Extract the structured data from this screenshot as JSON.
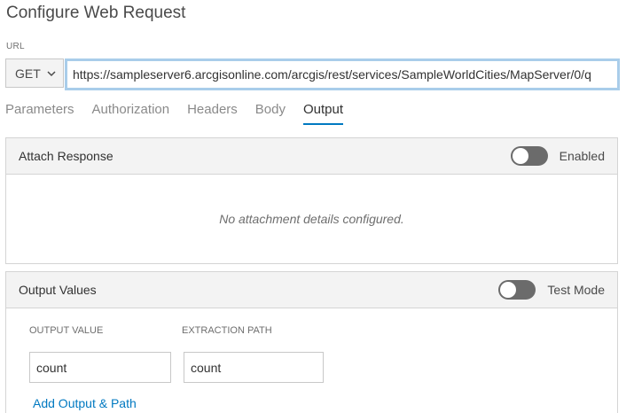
{
  "dialog": {
    "title": "Configure Web Request"
  },
  "url": {
    "label": "URL",
    "method": "GET",
    "value": "https://sampleserver6.arcgisonline.com/arcgis/rest/services/SampleWorldCities/MapServer/0/q"
  },
  "tabs": [
    {
      "label": "Parameters",
      "active": false
    },
    {
      "label": "Authorization",
      "active": false
    },
    {
      "label": "Headers",
      "active": false
    },
    {
      "label": "Body",
      "active": false
    },
    {
      "label": "Output",
      "active": true
    }
  ],
  "attach_response": {
    "title": "Attach Response",
    "toggle_label": "Enabled",
    "empty_message": "No attachment details configured."
  },
  "output_values": {
    "title": "Output Values",
    "toggle_label": "Test Mode",
    "columns": [
      "OUTPUT VALUE",
      "EXTRACTION PATH"
    ],
    "rows": [
      {
        "output_value": "count",
        "extraction_path": "count"
      }
    ],
    "add_link": "Add Output & Path"
  },
  "colors": {
    "accent": "#0079c1",
    "focus_border": "#a9cdea",
    "toggle_off": "#6b6b6b"
  }
}
